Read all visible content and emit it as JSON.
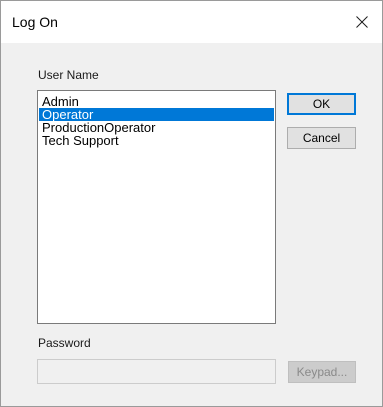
{
  "window": {
    "title": "Log On"
  },
  "user_name": {
    "label": "User Name",
    "items": [
      {
        "label": "Admin",
        "selected": false
      },
      {
        "label": "Operator",
        "selected": true
      },
      {
        "label": "ProductionOperator",
        "selected": false
      },
      {
        "label": "Tech Support",
        "selected": false
      }
    ]
  },
  "buttons": {
    "ok_label": "OK",
    "cancel_label": "Cancel",
    "keypad_label": "Keypad..."
  },
  "password": {
    "label": "Password",
    "value": "",
    "enabled": false
  },
  "colors": {
    "selection": "#0078d7",
    "default_button_border": "#0078d7"
  },
  "icons": {
    "close": "close-icon"
  }
}
